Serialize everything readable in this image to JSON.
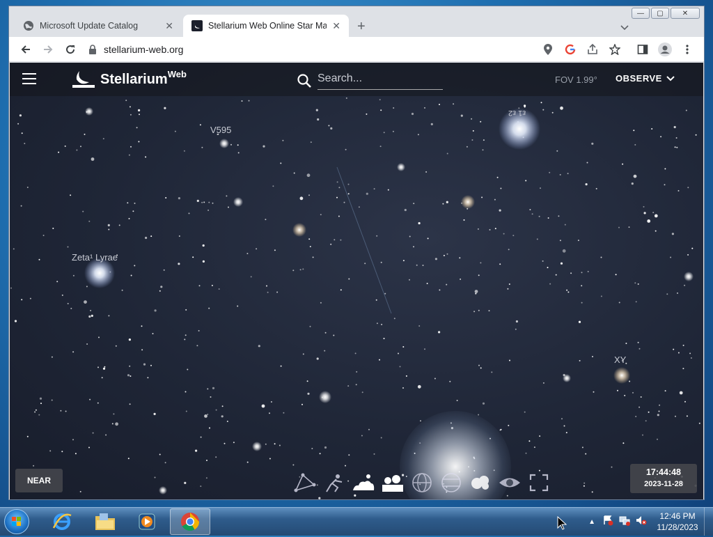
{
  "browser": {
    "tabs": [
      {
        "title": "Microsoft Update Catalog",
        "icon": "globe-icon",
        "active": false
      },
      {
        "title": "Stellarium Web Online Star Map",
        "icon": "stellarium-icon",
        "active": true
      }
    ],
    "new_tab_symbol": "+",
    "address": "stellarium-web.org",
    "window_controls": {
      "minimize": "—",
      "maximize": "▢",
      "close": "✕"
    }
  },
  "stellarium": {
    "brand": "Stellarium",
    "brand_sup": "Web",
    "search_placeholder": "Search...",
    "fov": "FOV 1.99°",
    "observe": "OBSERVE",
    "near": "NEAR",
    "time": "17:44:48",
    "date": "2023-11-28",
    "labels": {
      "v595": "V595",
      "zeta": "Zeta¹ Lyrae",
      "xy": "XY",
      "top_right": "ε1 ε2"
    },
    "bottom_toolbar": [
      "constellations-icon",
      "asterisms-icon",
      "landscape-icon",
      "atmosphere-icon",
      "azimuthal-grid-icon",
      "equatorial-grid-icon",
      "nebulae-icon",
      "dso-icon",
      "fullscreen-icon"
    ]
  },
  "taskbar": {
    "apps": [
      "start-orb",
      "internet-explorer-icon",
      "file-explorer-icon",
      "media-player-icon",
      "chrome-icon"
    ],
    "clock_time": "12:46 PM",
    "clock_date": "11/28/2023"
  },
  "colors": {
    "sky": "#1f2637",
    "header_overlay": "#14161c",
    "tab_strip": "#dee1e6",
    "taskbar": "#2f5c8c"
  }
}
